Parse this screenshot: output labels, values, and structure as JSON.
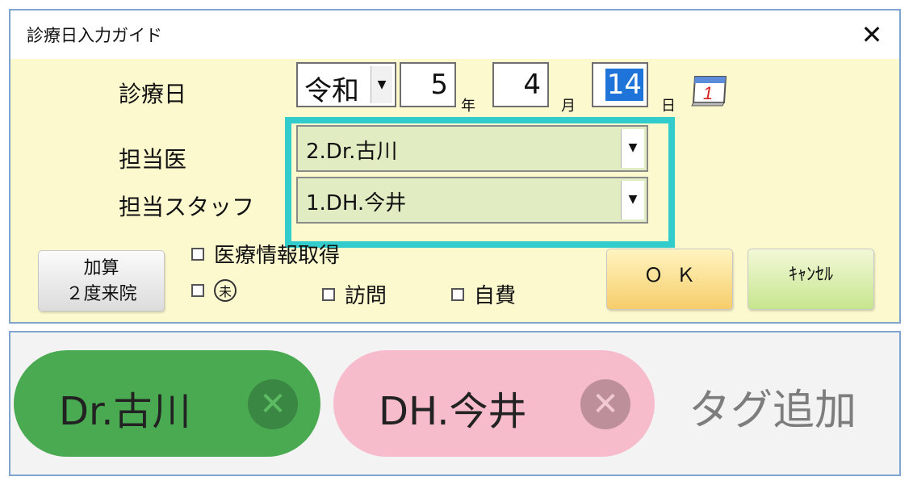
{
  "dialog": {
    "title": "診療日入力ガイド",
    "close_label": "✕",
    "labels": {
      "date": "診療日",
      "doctor": "担当医",
      "staff": "担当スタッフ"
    },
    "date": {
      "era": "令和",
      "year": "5",
      "year_unit": "年",
      "month": "4",
      "month_unit": "月",
      "day": "14",
      "day_unit": "日",
      "calendar_icon": "calendar-icon"
    },
    "doctor_select": {
      "value": "2.Dr.古川"
    },
    "staff_select": {
      "value": "1.DH.今井"
    },
    "buttons": {
      "kasan_line1": "加算",
      "kasan_line2": "２度来院",
      "ok": "ＯＫ",
      "cancel": "ｷｬﾝｾﾙ"
    },
    "checkboxes": {
      "medical_info": "医療情報取得",
      "circle_mark": "未",
      "visit": "訪問",
      "self_pay": "自費"
    },
    "highlight_color": "#33cccc"
  },
  "tags": {
    "items": [
      {
        "label": "Dr.古川",
        "color": "#4aaa52"
      },
      {
        "label": "DH.今井",
        "color": "#f7bccc"
      }
    ],
    "remove_glyph": "✕",
    "add_label": "タグ追加"
  }
}
